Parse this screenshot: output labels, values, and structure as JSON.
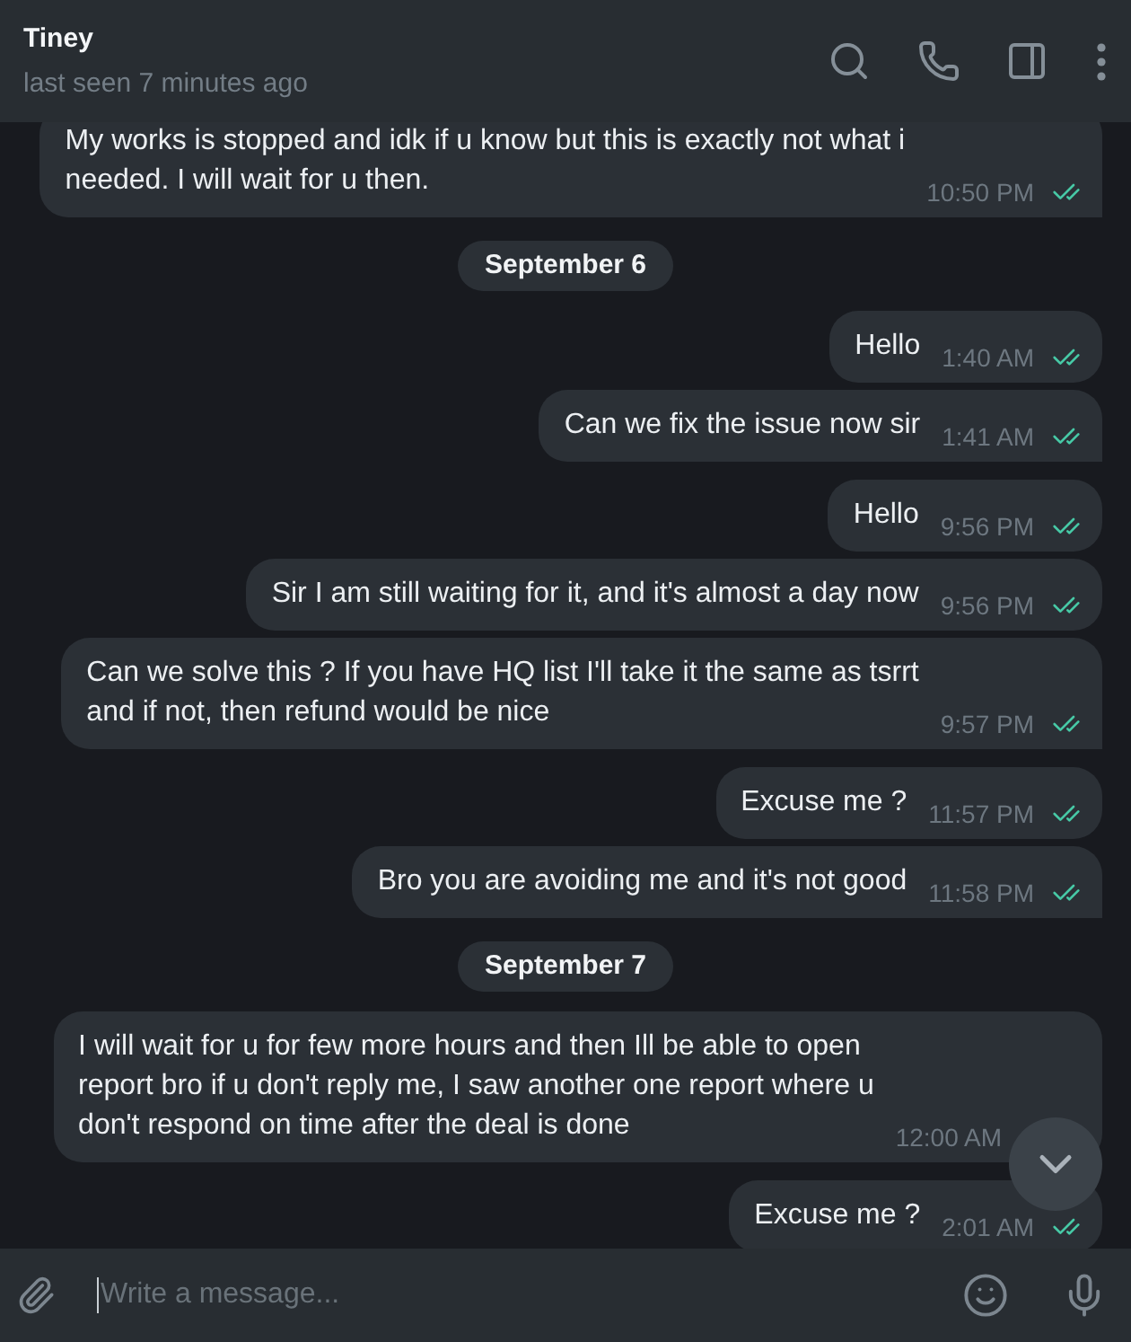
{
  "header": {
    "name": "Tiney",
    "status": "last seen 7 minutes ago"
  },
  "timeline": [
    {
      "kind": "message",
      "text": "My works is stopped and idk if u know but this is exactly not what i\nneeded. I will wait for u then.",
      "time": "10:50 PM",
      "read": true,
      "tail": true
    },
    {
      "kind": "date",
      "text": "September 6"
    },
    {
      "kind": "message",
      "text": "Hello",
      "time": "1:40 AM",
      "read": true,
      "tail": false
    },
    {
      "kind": "message",
      "text": "Can we fix the issue now sir",
      "time": "1:41 AM",
      "read": true,
      "tail": true
    },
    {
      "kind": "message",
      "text": "Hello",
      "time": "9:56 PM",
      "read": true,
      "tail": false
    },
    {
      "kind": "message",
      "text": "Sir I am still waiting for it, and it's almost a day now",
      "time": "9:56 PM",
      "read": true,
      "tail": false
    },
    {
      "kind": "message",
      "text": "Can we solve this ? If you have HQ list I'll take it the same as tsrrt\nand if not, then refund would be nice",
      "time": "9:57 PM",
      "read": true,
      "tail": true
    },
    {
      "kind": "message",
      "text": "Excuse me ?",
      "time": "11:57 PM",
      "read": true,
      "tail": false
    },
    {
      "kind": "message",
      "text": "Bro you are avoiding me and it's not good",
      "time": "11:58 PM",
      "read": true,
      "tail": true
    },
    {
      "kind": "date",
      "text": "September 7"
    },
    {
      "kind": "message",
      "text": "I will wait for u for few more hours and then Ill be able to open\nreport bro if u don't reply me, I saw another one report where u\ndon't respond on time after the deal is done",
      "time": "12:00 AM"
    },
    {
      "kind": "message",
      "text": "Excuse me ?",
      "time": "2:01 AM",
      "read": true
    }
  ],
  "composer": {
    "placeholder": "Write a message...",
    "focused": true
  }
}
